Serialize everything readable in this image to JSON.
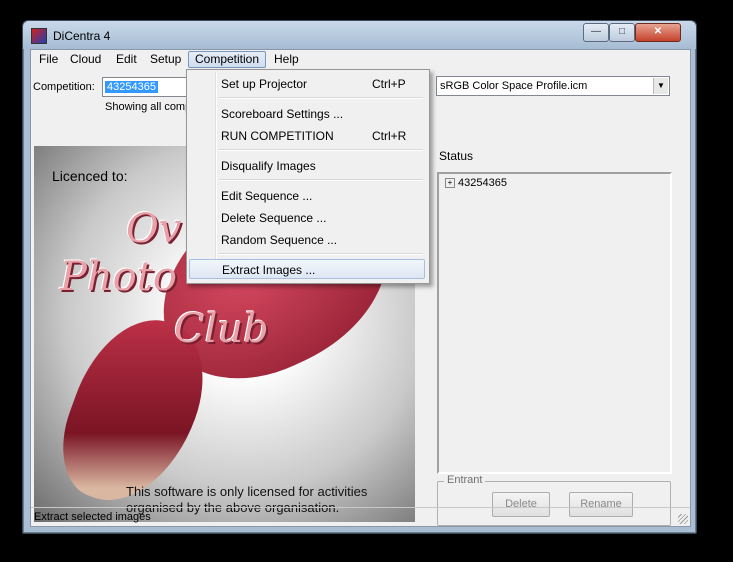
{
  "window": {
    "title": "DiCentra 4",
    "min": "—",
    "max": "□",
    "close": "✕"
  },
  "menubar": [
    "File",
    "Cloud",
    "Edit",
    "Setup",
    "Competition",
    "Help"
  ],
  "competition_label": "Competition:",
  "competition_value": "43254365",
  "showing_text": "Showing all comp",
  "profile_combo": "sRGB Color Space Profile.icm",
  "picture": {
    "licenced": "Licenced to:",
    "logo_line1": "Ov",
    "logo_line2": "Photo",
    "logo_line3": "Club",
    "notice_line1": "This software is only licensed for activities",
    "notice_line2": "organised by the above organisation."
  },
  "status": {
    "label": "Status",
    "tree_item": "43254365"
  },
  "entrant": {
    "title": "Entrant",
    "delete": "Delete",
    "rename": "Rename"
  },
  "statusbar": "Extract selected images",
  "competition_menu": [
    {
      "label": "Set up Projector",
      "shortcut": "Ctrl+P"
    },
    {
      "label": "Scoreboard Settings ...",
      "shortcut": ""
    },
    {
      "label": "RUN COMPETITION",
      "shortcut": "Ctrl+R"
    },
    {
      "label": "Disqualify Images",
      "shortcut": ""
    },
    {
      "label": "Edit Sequence ...",
      "shortcut": ""
    },
    {
      "label": "Delete Sequence ...",
      "shortcut": ""
    },
    {
      "label": "Random Sequence ...",
      "shortcut": ""
    },
    {
      "label": "Extract Images ...",
      "shortcut": ""
    }
  ],
  "colors": {
    "selection": "#3399ff",
    "titlebar": "#a6bcd3",
    "petal": "#c7354d"
  }
}
